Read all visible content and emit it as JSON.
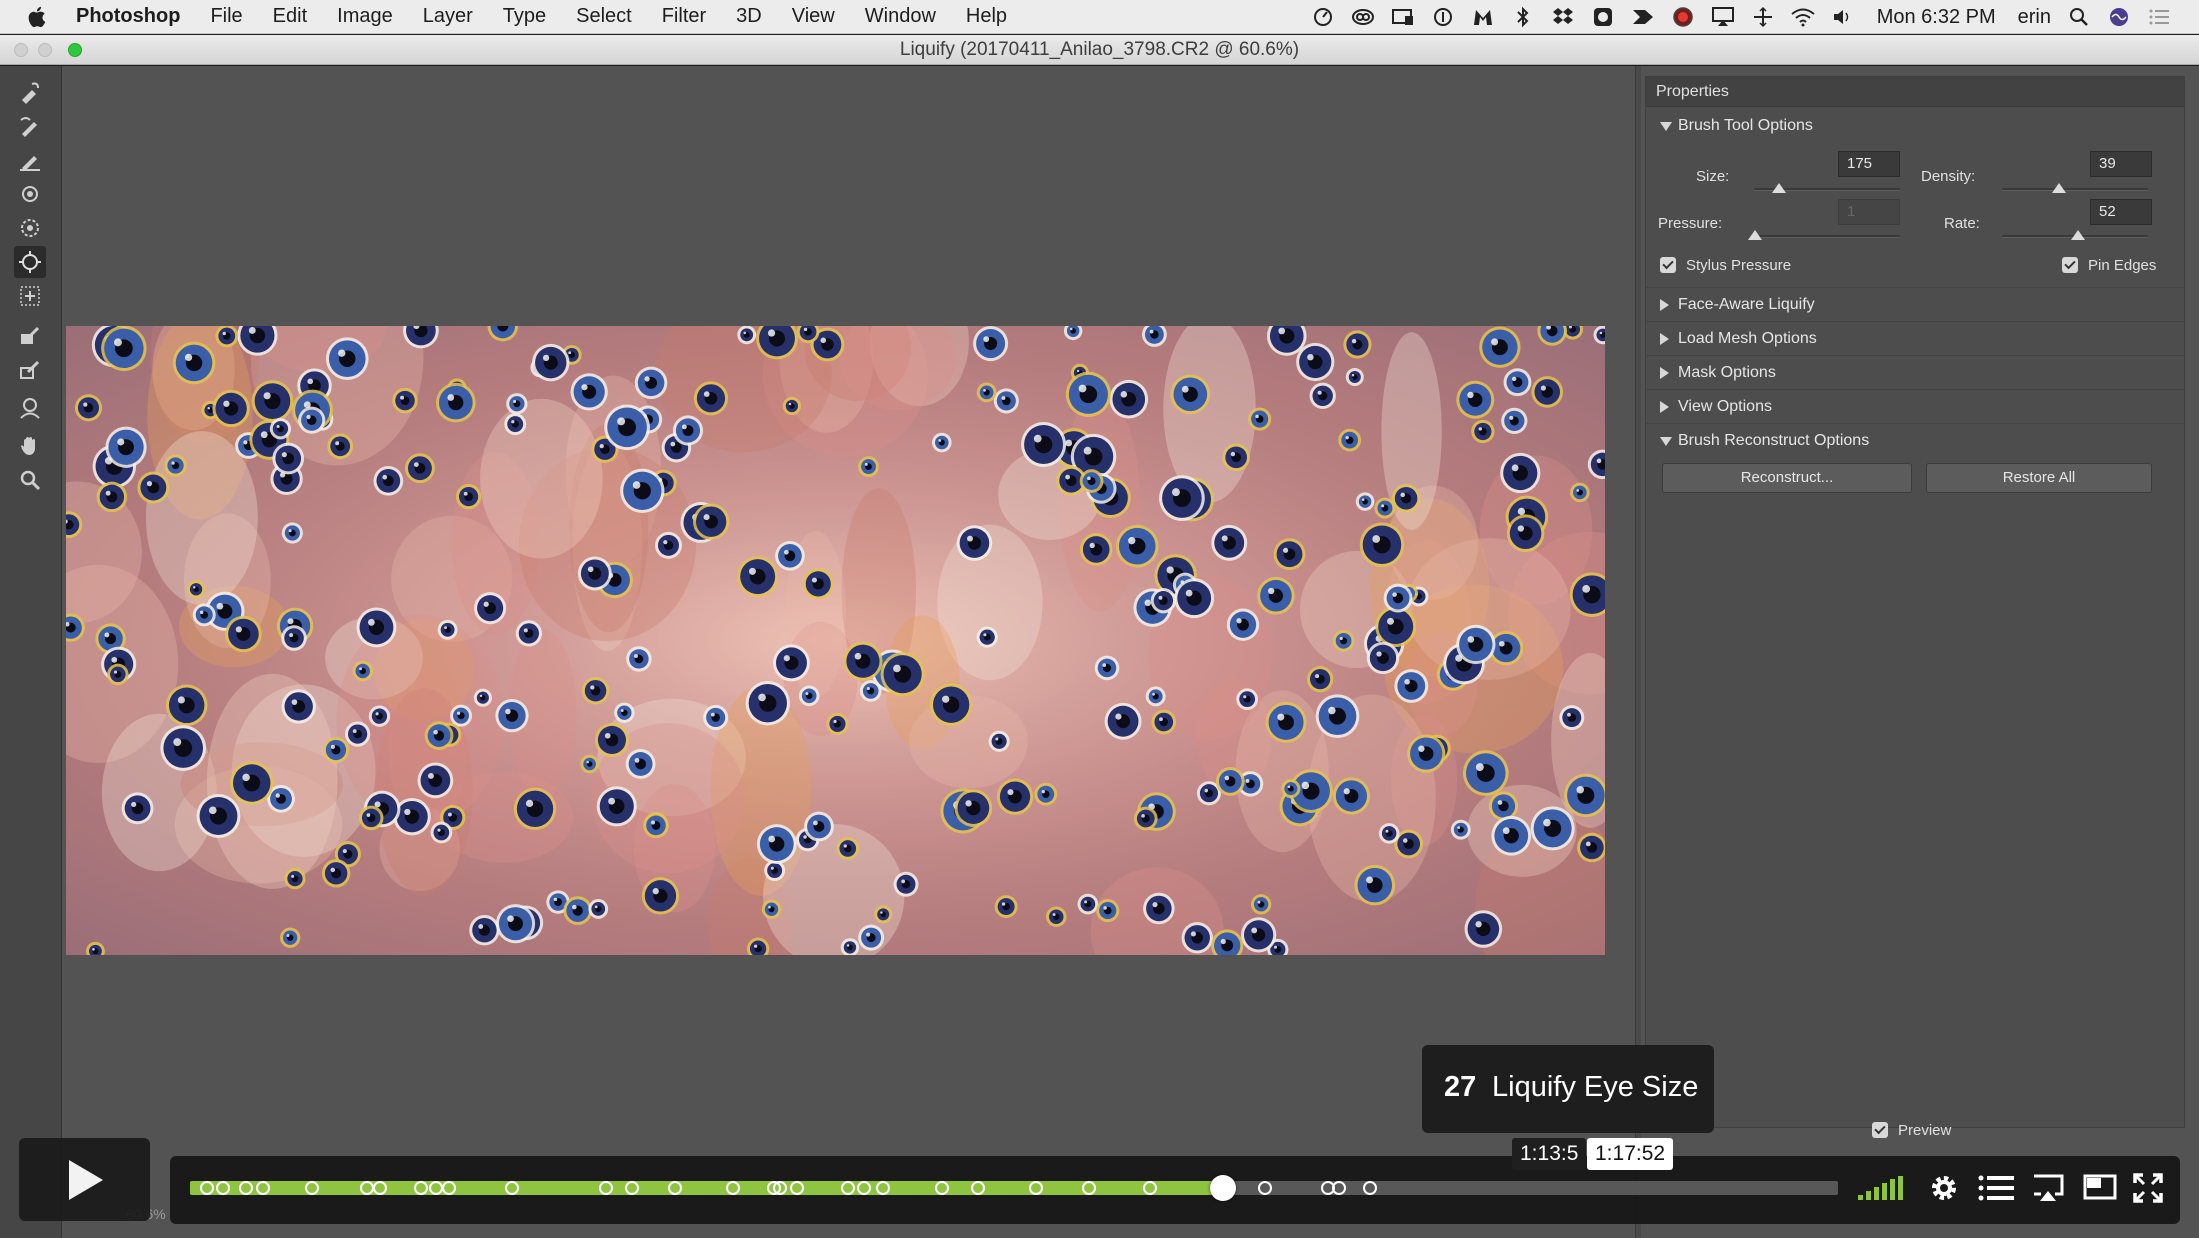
{
  "menubar": {
    "app_name": "Photoshop",
    "menus": [
      "File",
      "Edit",
      "Image",
      "Layer",
      "Type",
      "Select",
      "Filter",
      "3D",
      "View",
      "Window",
      "Help"
    ],
    "clock": "Mon 6:32 PM",
    "user": "erin"
  },
  "window": {
    "title": "Liquify (20170411_Anilao_3798.CR2 @ 60.6%)"
  },
  "properties": {
    "header": "Properties",
    "brush_tool_options": {
      "label": "Brush Tool Options",
      "size_label": "Size:",
      "size_value": "175",
      "size_level": 0.17,
      "density_label": "Density:",
      "density_value": "39",
      "density_level": 0.39,
      "pressure_label": "Pressure:",
      "pressure_value": "1",
      "pressure_level": 0.01,
      "rate_label": "Rate:",
      "rate_value": "52",
      "rate_level": 0.52,
      "stylus_label": "Stylus Pressure",
      "pin_edges_label": "Pin Edges"
    },
    "sections": {
      "face_aware": "Face-Aware Liquify",
      "load_mesh": "Load Mesh Options",
      "mask": "Mask Options",
      "view": "View Options",
      "reconstruct": "Brush Reconstruct Options"
    },
    "reconstruct_button": "Reconstruct...",
    "restore_all_button": "Restore All",
    "preview_label": "Preview"
  },
  "statusbar": {
    "zoom": "60.6%"
  },
  "player": {
    "chapter_number": "27",
    "chapter_title": "Liquify Eye Size",
    "hover_time": "1:13:5",
    "current_time": "1:17:52",
    "progress": 0.627,
    "accent_color": "#8ec43f"
  }
}
